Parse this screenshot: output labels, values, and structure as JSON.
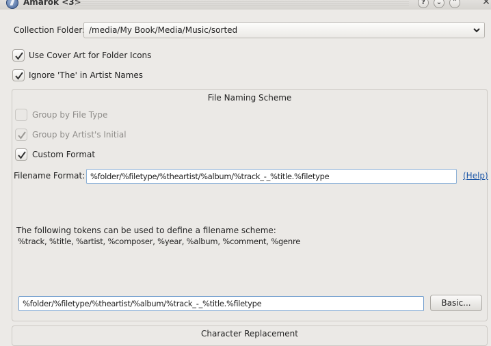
{
  "window": {
    "title": "Amarok <3>",
    "buttons": {
      "help": "?",
      "minimize": "⌄",
      "maximize": "⌃",
      "close": "✕"
    }
  },
  "collection": {
    "label": "Collection Folder:",
    "value": "/media/My Book/Media/Music/sorted"
  },
  "options": {
    "cover_art": {
      "label": "Use Cover Art for Folder Icons",
      "checked": true
    },
    "ignore_the": {
      "label": "Ignore 'The' in Artist Names",
      "checked": true
    }
  },
  "naming_scheme": {
    "title": "File Naming Scheme",
    "group_by_type": {
      "label": "Group by File Type",
      "checked": false,
      "enabled": false
    },
    "group_by_initial": {
      "label": "Group by Artist's Initial",
      "checked": true,
      "enabled": false
    },
    "custom_format": {
      "label": "Custom Format",
      "checked": true
    },
    "filename_format_label": "Filename Format:",
    "filename_format_value": "%folder/%filetype/%theartist/%album/%track_-_%title.%filetype",
    "help_link": "(Help)",
    "tokens_intro": "The following tokens can be used to define a filename scheme:",
    "tokens_list": "%track, %title, %artist, %composer, %year, %album, %comment, %genre",
    "scheme_value": "%folder/%filetype/%theartist/%album/%track_-_%title.%filetype",
    "basic_button": "Basic..."
  },
  "char_replacement": {
    "title": "Character Replacement"
  }
}
